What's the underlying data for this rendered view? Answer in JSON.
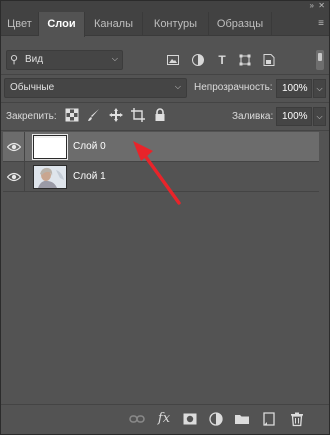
{
  "tabs": [
    {
      "label": "Цвет",
      "active": false
    },
    {
      "label": "Слои",
      "active": true
    },
    {
      "label": "Каналы",
      "active": false
    },
    {
      "label": "Контуры",
      "active": false
    },
    {
      "label": "Образцы",
      "active": false
    }
  ],
  "filter": {
    "kind_label": "Вид",
    "icons": [
      "image-filter-icon",
      "adjustment-filter-icon",
      "type-filter-icon",
      "shape-filter-icon",
      "smart-object-filter-icon"
    ]
  },
  "blend": {
    "mode": "Обычные",
    "opacity_label": "Непрозрачность:",
    "opacity_value": "100%"
  },
  "lock": {
    "label": "Закрепить:",
    "icons": [
      "lock-transparent-icon",
      "lock-image-icon",
      "lock-position-icon",
      "artboard-icon",
      "lock-all-icon"
    ],
    "fill_label": "Заливка:",
    "fill_value": "100%"
  },
  "layers": [
    {
      "name": "Слой 0",
      "visible": true,
      "selected": true
    },
    {
      "name": "Слой 1",
      "visible": true,
      "selected": false
    }
  ],
  "colors": {
    "panel_bg": "#535353",
    "tabbar_bg": "#424242",
    "selected_row": "#6c6c6c",
    "annotation_arrow": "#e8242a"
  },
  "bottom_icons": [
    "link-layers-icon",
    "layer-style-icon",
    "add-mask-icon",
    "adjustment-layer-icon",
    "new-group-icon",
    "new-layer-icon",
    "delete-layer-icon"
  ]
}
